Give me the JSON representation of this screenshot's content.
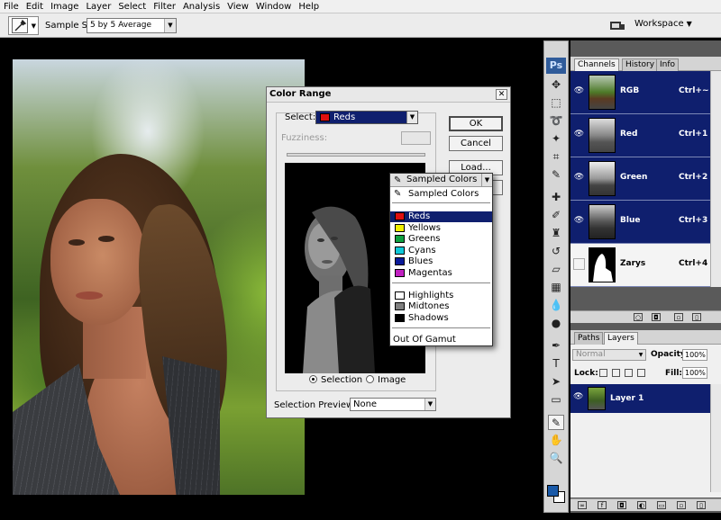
{
  "menubar": [
    "File",
    "Edit",
    "Image",
    "Layer",
    "Select",
    "Filter",
    "Analysis",
    "View",
    "Window",
    "Help"
  ],
  "options": {
    "sample_size_label": "Sample Size:",
    "sample_size_value": "5 by 5 Average",
    "workspace_label": "Workspace"
  },
  "dialog": {
    "title": "Color Range",
    "select_label": "Select:",
    "select_value": "Reds",
    "select_color": "#e01010",
    "fuzziness_label": "Fuzziness:",
    "ok": "OK",
    "cancel": "Cancel",
    "load": "Load...",
    "selection_radio": "Selection",
    "image_radio": "Image",
    "selection_preview_label": "Selection Preview:",
    "selection_preview_value": "None"
  },
  "dropdown": {
    "header": "Sampled Colors",
    "items": [
      {
        "label": "Sampled Colors",
        "color": ""
      },
      {
        "label": "Reds",
        "color": "#e01010"
      },
      {
        "label": "Yellows",
        "color": "#f0f000"
      },
      {
        "label": "Greens",
        "color": "#10a040"
      },
      {
        "label": "Cyans",
        "color": "#10c8d8"
      },
      {
        "label": "Blues",
        "color": "#0a1a9a"
      },
      {
        "label": "Magentas",
        "color": "#c020c0"
      },
      {
        "label": "Highlights",
        "color": "#ffffff"
      },
      {
        "label": "Midtones",
        "color": "#808080"
      },
      {
        "label": "Shadows",
        "color": "#000000"
      },
      {
        "label": "Out Of Gamut",
        "color": ""
      }
    ],
    "active_index": 1
  },
  "tabs_top": [
    "Channels",
    "History",
    "Info"
  ],
  "channels": [
    {
      "name": "RGB",
      "shortcut": "Ctrl+~"
    },
    {
      "name": "Red",
      "shortcut": "Ctrl+1"
    },
    {
      "name": "Green",
      "shortcut": "Ctrl+2"
    },
    {
      "name": "Blue",
      "shortcut": "Ctrl+3"
    },
    {
      "name": "Zarys",
      "shortcut": "Ctrl+4"
    }
  ],
  "tabs_bottom": [
    "Paths",
    "Layers"
  ],
  "layers": {
    "blend_mode": "Normal",
    "opacity_label": "Opacity:",
    "opacity": "100%",
    "lock_label": "Lock:",
    "fill_label": "Fill:",
    "fill": "100%",
    "layer_name": "Layer 1"
  },
  "colors": {
    "selection_blue": "#0f1f6e",
    "foreground": "#1a5aa8",
    "background": "#ffffff"
  }
}
